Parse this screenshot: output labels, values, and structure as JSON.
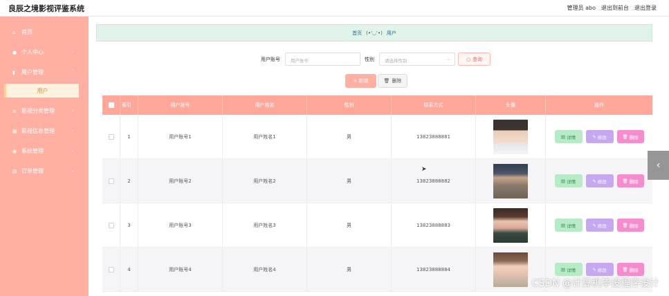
{
  "header": {
    "title": "良辰之境影视评鉴系统",
    "admin_label": "管理员 abo",
    "go_front": "退出到前台",
    "logout": "退出登录"
  },
  "sidebar": {
    "items": [
      {
        "label": "首页",
        "icon": "home-icon"
      },
      {
        "label": "个人中心",
        "icon": "person-icon"
      },
      {
        "label": "用户管理",
        "icon": "bar-chart-icon"
      },
      {
        "label": "影视分类管理",
        "icon": "list-icon"
      },
      {
        "label": "影视信息管理",
        "icon": "grid-icon"
      },
      {
        "label": "系统管理",
        "icon": "location-icon"
      },
      {
        "label": "订单管理",
        "icon": "table-icon"
      }
    ],
    "active_sub": "用户"
  },
  "breadcrumb": {
    "home": "首页",
    "face": "(•'◡'•)",
    "current": "用户"
  },
  "search": {
    "account_label": "用户账号",
    "account_placeholder": "用户账号",
    "gender_label": "性别",
    "gender_placeholder": "请选择性别",
    "button": "查询"
  },
  "actions": {
    "add": "+ 新增",
    "delete": "删除"
  },
  "table": {
    "columns": [
      "索引",
      "用户账号",
      "用户姓名",
      "性别",
      "联系方式",
      "头像",
      "操作"
    ],
    "rows": [
      {
        "index": "1",
        "account": "用户账号1",
        "name": "用户姓名1",
        "gender": "男",
        "phone": "13823888881"
      },
      {
        "index": "2",
        "account": "用户账号2",
        "name": "用户姓名2",
        "gender": "男",
        "phone": "13823888882"
      },
      {
        "index": "3",
        "account": "用户账号3",
        "name": "用户姓名3",
        "gender": "男",
        "phone": "13823888883"
      },
      {
        "index": "4",
        "account": "用户账号4",
        "name": "用户姓名4",
        "gender": "男",
        "phone": "13823888884"
      }
    ],
    "ops": {
      "detail": "详情",
      "edit": "修改",
      "remove": "删除"
    }
  },
  "watermark": "CSDN @计算机毕设程序设计",
  "colors": {
    "sidebar": "#ffb0a3",
    "header_row": "#ffa79b",
    "detail": "#b7ebc7",
    "edit": "#c6a8f0",
    "remove": "#f58ccc"
  }
}
